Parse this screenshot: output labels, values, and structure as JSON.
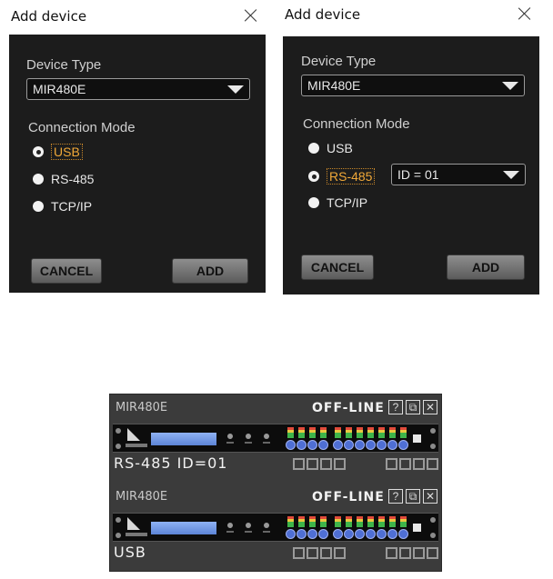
{
  "dialog_usb": {
    "title": "Add device",
    "device_type_label": "Device Type",
    "device_type_value": "MIR480E",
    "connection_mode_label": "Connection Mode",
    "options": [
      "USB",
      "RS-485",
      "TCP/IP"
    ],
    "selected": "USB",
    "cancel_label": "CANCEL",
    "add_label": "ADD"
  },
  "dialog_rs485": {
    "title": "Add device",
    "device_type_label": "Device Type",
    "device_type_value": "MIR480E",
    "connection_mode_label": "Connection Mode",
    "options": [
      "USB",
      "RS-485",
      "TCP/IP"
    ],
    "selected": "RS-485",
    "id_value": "ID = 01",
    "cancel_label": "CANCEL",
    "add_label": "ADD"
  },
  "devices": [
    {
      "model": "MIR480E",
      "status": "OFF-LINE",
      "connection": "RS-485  ID=01"
    },
    {
      "model": "MIR480E",
      "status": "OFF-LINE",
      "connection": "USB"
    }
  ],
  "device_icons": {
    "help": "?",
    "restore": "⧉",
    "close": "✕"
  },
  "colors": {
    "dialog_bg": "#1c1c1c",
    "selected_option": "#f0a838",
    "lcd": "#7a9ee8",
    "jack": "#4f6fd4"
  }
}
